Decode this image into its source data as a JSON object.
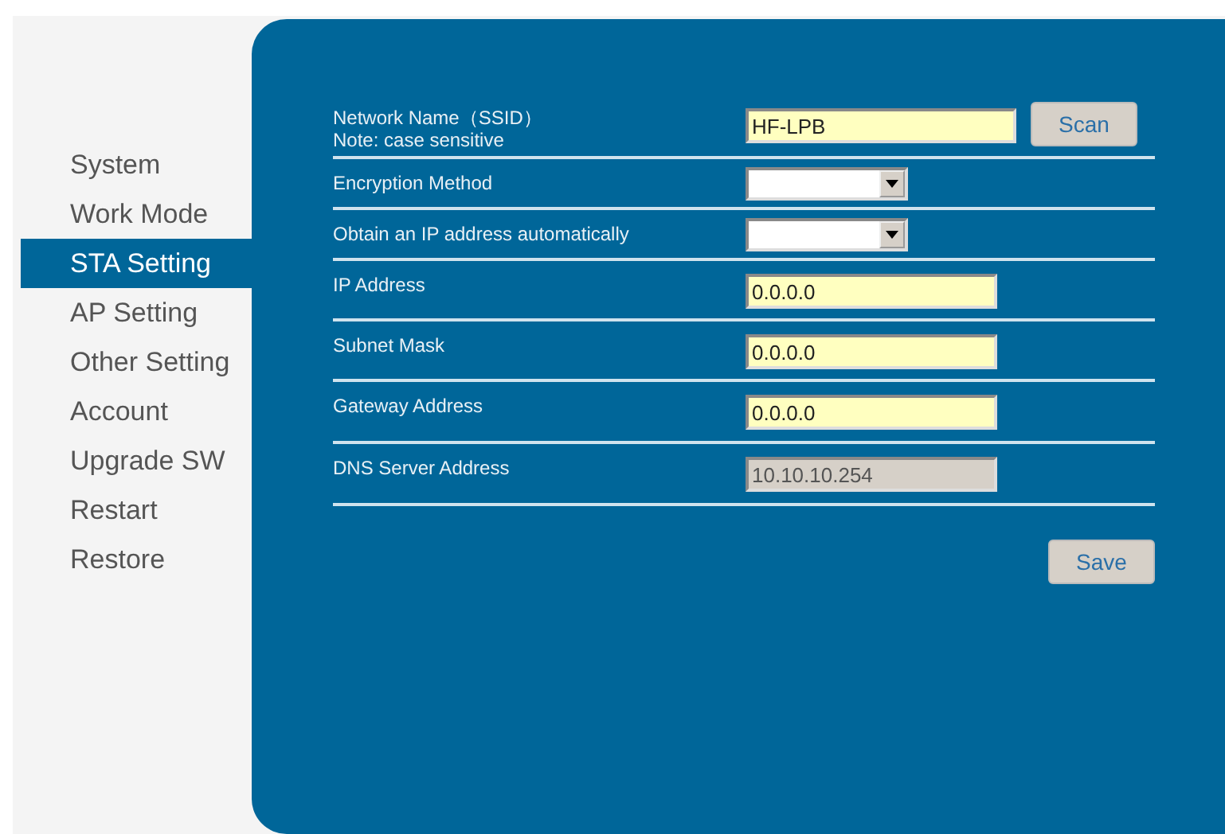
{
  "sidebar": {
    "items": [
      {
        "label": "System",
        "selected": false
      },
      {
        "label": "Work Mode",
        "selected": false
      },
      {
        "label": "STA Setting",
        "selected": true
      },
      {
        "label": "AP Setting",
        "selected": false
      },
      {
        "label": "Other Setting",
        "selected": false
      },
      {
        "label": "Account",
        "selected": false
      },
      {
        "label": "Upgrade SW",
        "selected": false
      },
      {
        "label": "Restart",
        "selected": false
      },
      {
        "label": "Restore",
        "selected": false
      }
    ]
  },
  "form": {
    "rows": [
      {
        "label": "Network Name（SSID）",
        "note": "Note: case sensitive",
        "kind": "text",
        "value": "HF-LPB",
        "disabled": false,
        "button": "Scan"
      },
      {
        "label": "Encryption Method",
        "kind": "select"
      },
      {
        "label": "Obtain an IP address automatically",
        "kind": "select"
      },
      {
        "label": "IP Address",
        "kind": "text",
        "value": "0.0.0.0",
        "disabled": false
      },
      {
        "label": "Subnet Mask",
        "kind": "text",
        "value": "0.0.0.0",
        "disabled": false
      },
      {
        "label": "Gateway Address",
        "kind": "text",
        "value": "0.0.0.0",
        "disabled": false
      },
      {
        "label": "DNS Server Address",
        "kind": "text",
        "value": "10.10.10.254",
        "disabled": true
      }
    ],
    "save_button": "Save"
  }
}
